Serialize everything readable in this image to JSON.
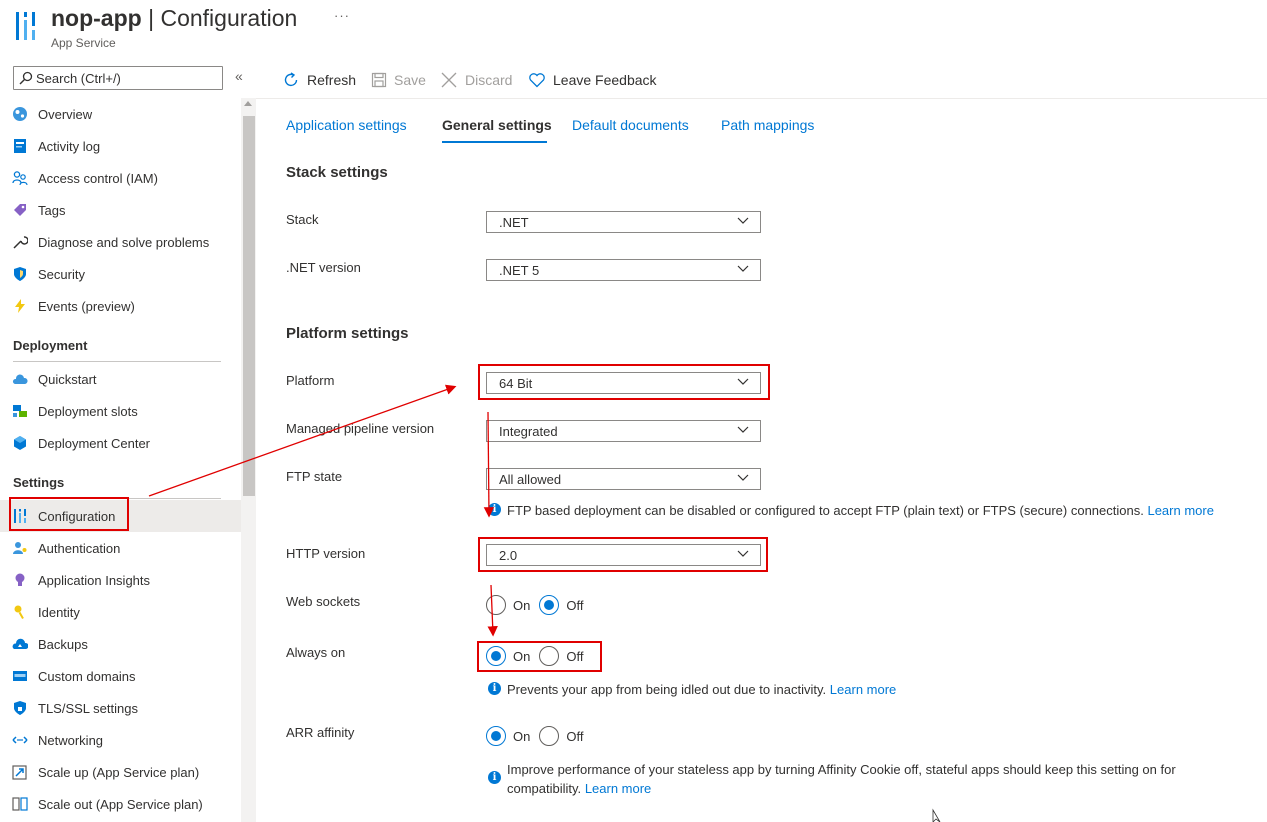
{
  "header": {
    "app_name": "nop-app",
    "separator": "|",
    "page_title": "Configuration",
    "subtitle": "App Service",
    "more": "···"
  },
  "sidebar": {
    "search_placeholder": "Search (Ctrl+/)",
    "collapse": "«",
    "items_top": [
      {
        "label": "Overview",
        "icon": "globe-icon"
      },
      {
        "label": "Activity log",
        "icon": "log-icon"
      },
      {
        "label": "Access control (IAM)",
        "icon": "people-icon"
      },
      {
        "label": "Tags",
        "icon": "tag-icon"
      },
      {
        "label": "Diagnose and solve problems",
        "icon": "wrench-icon"
      },
      {
        "label": "Security",
        "icon": "shield-icon"
      },
      {
        "label": "Events (preview)",
        "icon": "lightning-icon"
      }
    ],
    "section_deployment": "Deployment",
    "items_deployment": [
      {
        "label": "Quickstart",
        "icon": "cloud-icon"
      },
      {
        "label": "Deployment slots",
        "icon": "slots-icon"
      },
      {
        "label": "Deployment Center",
        "icon": "cube-icon"
      }
    ],
    "section_settings": "Settings",
    "items_settings": [
      {
        "label": "Configuration",
        "icon": "configuration-icon",
        "selected": true
      },
      {
        "label": "Authentication",
        "icon": "person-key-icon"
      },
      {
        "label": "Application Insights",
        "icon": "bulb-icon"
      },
      {
        "label": "Identity",
        "icon": "key-icon"
      },
      {
        "label": "Backups",
        "icon": "cloud-backup-icon"
      },
      {
        "label": "Custom domains",
        "icon": "domain-icon"
      },
      {
        "label": "TLS/SSL settings",
        "icon": "shield-lock-icon"
      },
      {
        "label": "Networking",
        "icon": "network-icon"
      },
      {
        "label": "Scale up (App Service plan)",
        "icon": "scale-up-icon"
      },
      {
        "label": "Scale out (App Service plan)",
        "icon": "scale-out-icon"
      }
    ]
  },
  "toolbar": {
    "refresh": "Refresh",
    "save": "Save",
    "discard": "Discard",
    "feedback": "Leave Feedback"
  },
  "tabs": [
    "Application settings",
    "General settings",
    "Default documents",
    "Path mappings"
  ],
  "active_tab": "General settings",
  "stack_settings": {
    "title": "Stack settings",
    "stack_label": "Stack",
    "stack_value": ".NET",
    "version_label": ".NET version",
    "version_value": ".NET 5"
  },
  "platform_settings": {
    "title": "Platform settings",
    "platform_label": "Platform",
    "platform_value": "64 Bit",
    "pipeline_label": "Managed pipeline version",
    "pipeline_value": "Integrated",
    "ftp_label": "FTP state",
    "ftp_value": "All allowed",
    "ftp_info": "FTP based deployment can be disabled or configured to accept FTP (plain text) or FTPS (secure) connections.",
    "learn_more": "Learn more",
    "http_label": "HTTP version",
    "http_value": "2.0",
    "websockets_label": "Web sockets",
    "websockets_value": "Off",
    "alwayson_label": "Always on",
    "alwayson_value": "On",
    "alwayson_info": "Prevents your app from being idled out due to inactivity.",
    "arr_label": "ARR affinity",
    "arr_value": "On",
    "arr_info_line1": "Improve performance of your stateless app by turning Affinity Cookie off, stateful apps should keep this setting on for",
    "arr_info_line2": "compatibility.",
    "on": "On",
    "off": "Off"
  },
  "colors": {
    "accent": "#0078d4",
    "annotation": "#e00000"
  }
}
